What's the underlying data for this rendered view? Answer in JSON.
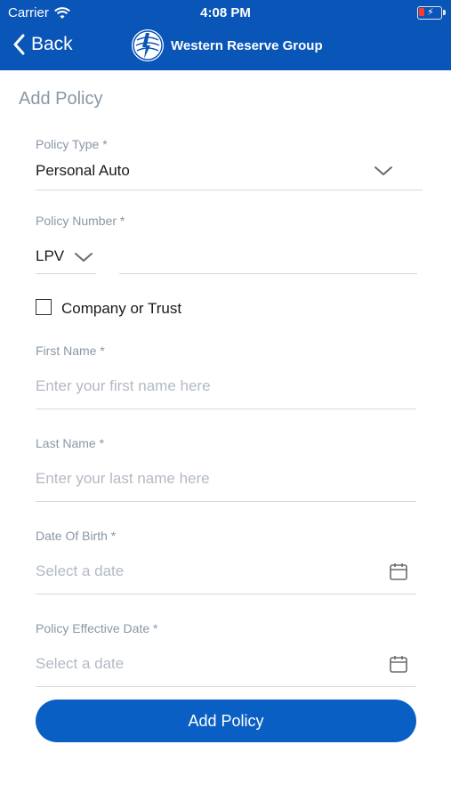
{
  "status_bar": {
    "carrier": "Carrier",
    "time": "4:08 PM"
  },
  "nav": {
    "back_label": "Back",
    "brand_name": "Western Reserve Group"
  },
  "form": {
    "title": "Add Policy",
    "policy_type": {
      "label": "Policy Type *",
      "value": "Personal Auto"
    },
    "policy_number": {
      "label": "Policy Number *",
      "prefix": "LPV",
      "value": ""
    },
    "company_or_trust": {
      "label": "Company or Trust",
      "checked": false
    },
    "first_name": {
      "label": "First Name *",
      "placeholder": "Enter your first name here"
    },
    "last_name": {
      "label": "Last Name *",
      "placeholder": "Enter your last name here"
    },
    "date_of_birth": {
      "label": "Date Of Birth *",
      "placeholder": "Select a date"
    },
    "policy_effective_date": {
      "label": "Policy Effective Date *",
      "placeholder": "Select a date"
    },
    "submit_label": "Add Policy"
  },
  "colors": {
    "brand_blue": "#0a55b8",
    "button_blue": "#0a5fc4",
    "label_gray": "#8a97a6"
  },
  "icons": [
    "wifi-icon",
    "battery-icon",
    "back-chevron-icon",
    "brand-logo",
    "chevron-down-icon",
    "calendar-icon"
  ]
}
